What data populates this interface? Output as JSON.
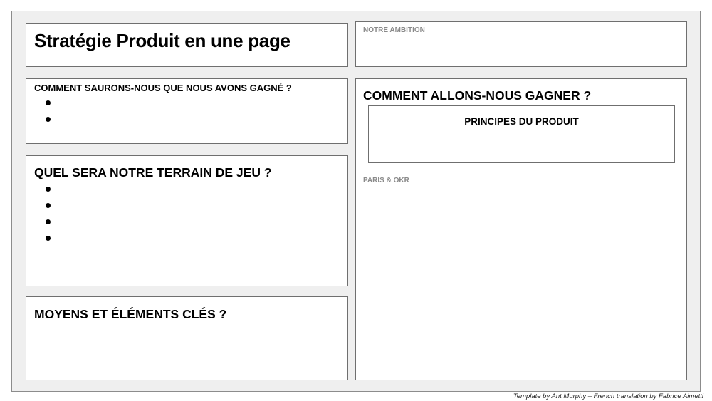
{
  "title": "Stratégie Produit en une page",
  "ambition": {
    "label": "NOTRE AMBITION"
  },
  "win_criteria": {
    "heading": "COMMENT SAURONS-NOUS QUE NOUS AVONS GAGNÉ ?",
    "bullet_count": 2
  },
  "terrain": {
    "heading": "QUEL SERA NOTRE TERRAIN DE JEU ?",
    "bullet_count": 4
  },
  "means": {
    "heading": "MOYENS ET ÉLÉMENTS CLÉS ?"
  },
  "how_to_win": {
    "heading": "COMMENT ALLONS-NOUS GAGNER ?",
    "principles_heading": "PRINCIPES DU PRODUIT",
    "bets_label": "PARIS & OKR"
  },
  "footer": "Template by Ant Murphy – French translation by Fabrice Aimetti",
  "colors": {
    "frame_background": "#efefef",
    "box_border": "#6f6f6f",
    "muted_label": "#8a8a8a"
  }
}
